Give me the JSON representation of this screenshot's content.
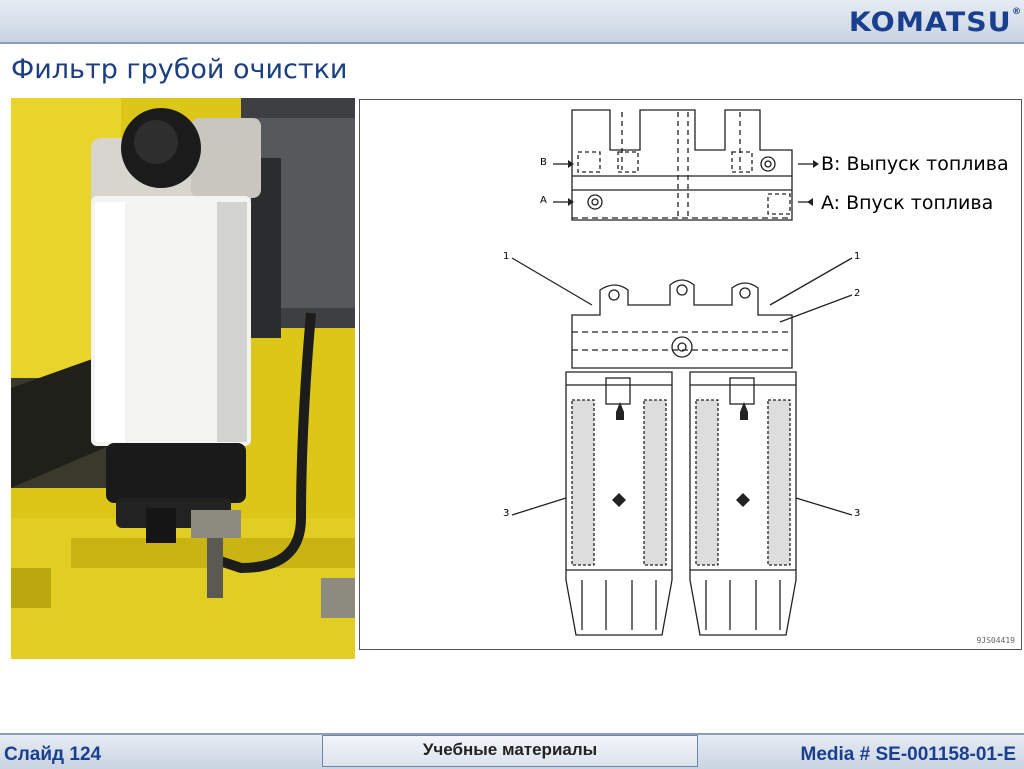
{
  "header": {
    "logo": "KOMATSU",
    "logo_mark": "®"
  },
  "page": {
    "title": "Фильтр грубой очистки"
  },
  "diagram": {
    "label_b": "B: Выпуск топлива",
    "label_a": "A: Впуск топлива",
    "code": "9JS04419",
    "callout_left_top": "1",
    "callout_right_top": "1",
    "callout_right_mid": "2",
    "callout_left_bottom": "3",
    "callout_right_bottom": "3",
    "port_b": "B",
    "port_a": "A"
  },
  "footer": {
    "slide": "Слайд 124",
    "center": "Учебные материалы",
    "media": "Media # SE-001158-01-E"
  }
}
